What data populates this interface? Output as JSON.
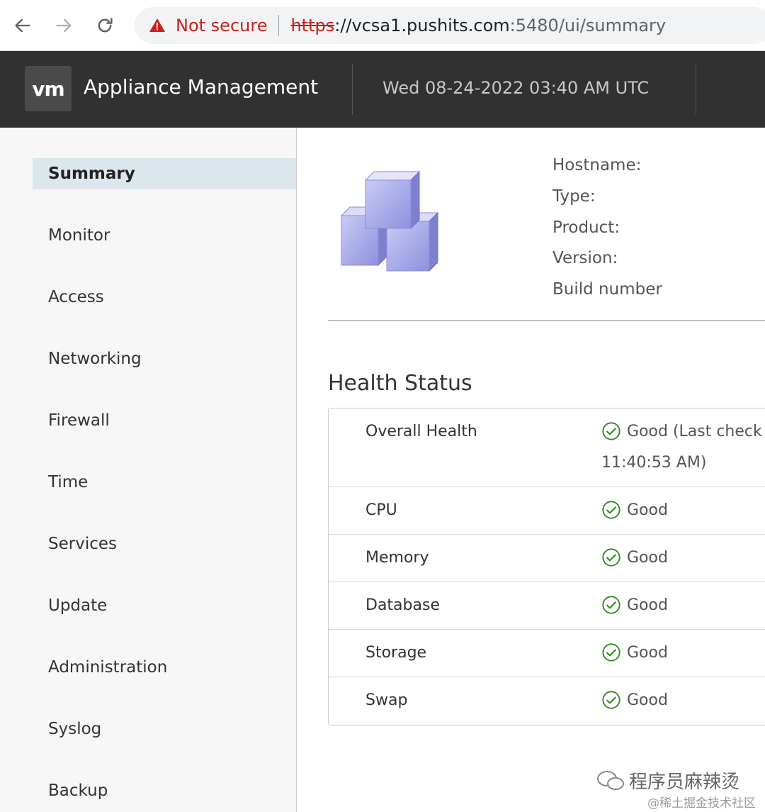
{
  "browser": {
    "back_icon": "arrow-left-icon",
    "forward_icon": "arrow-right-icon",
    "reload_icon": "reload-icon",
    "security_warning": "Not secure",
    "url_scheme": "https",
    "url_sep": "://",
    "url_host": "vcsa1.pushits.com",
    "url_path": ":5480/ui/summary",
    "warning_color": "#c5221f"
  },
  "header": {
    "logo": "vm",
    "title": "Appliance Management",
    "datetime": "Wed 08-24-2022 03:40 AM UTC",
    "background": "#313131"
  },
  "sidebar": {
    "items": [
      {
        "label": "Summary",
        "active": true
      },
      {
        "label": "Monitor"
      },
      {
        "label": "Access"
      },
      {
        "label": "Networking"
      },
      {
        "label": "Firewall"
      },
      {
        "label": "Time"
      },
      {
        "label": "Services"
      },
      {
        "label": "Update"
      },
      {
        "label": "Administration"
      },
      {
        "label": "Syslog"
      },
      {
        "label": "Backup"
      }
    ]
  },
  "summary": {
    "icon": "appliance-cubes-icon",
    "labels": [
      "Hostname:",
      "Type:",
      "Product:",
      "Version:",
      "Build number"
    ]
  },
  "health": {
    "title": "Health Status",
    "rows": [
      {
        "name": "Overall Health",
        "status": "Good (Last check",
        "status_line2": "11:40:53 AM)"
      },
      {
        "name": "CPU",
        "status": "Good"
      },
      {
        "name": "Memory",
        "status": "Good"
      },
      {
        "name": "Database",
        "status": "Good"
      },
      {
        "name": "Storage",
        "status": "Good"
      },
      {
        "name": "Swap",
        "status": "Good"
      }
    ],
    "good_color": "#2e8b1e"
  },
  "watermark": {
    "text": "程序员麻辣烫",
    "sub": "@稀土掘金技术社区"
  }
}
